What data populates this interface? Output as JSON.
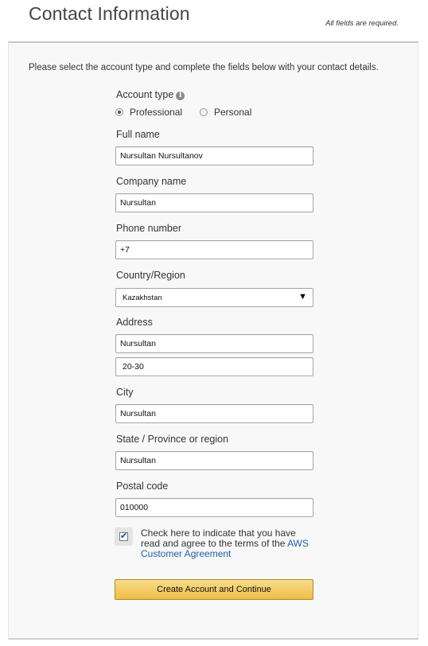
{
  "header": {
    "title": "Contact Information",
    "required_note": "All fields are required."
  },
  "intro": "Please select the account type and complete the fields below with your contact details.",
  "account_type": {
    "label": "Account type",
    "info_icon": "info-icon",
    "options": [
      {
        "label": "Professional",
        "selected": true
      },
      {
        "label": "Personal",
        "selected": false
      }
    ]
  },
  "fields": {
    "full_name": {
      "label": "Full name",
      "value": "Nursultan Nursultanov"
    },
    "company_name": {
      "label": "Company name",
      "value": "Nursultan"
    },
    "phone_number": {
      "label": "Phone number",
      "value": "+7"
    },
    "country": {
      "label": "Country/Region",
      "value": "Kazakhstan"
    },
    "address": {
      "label": "Address",
      "line1": "Nursultan",
      "line2": "20-30"
    },
    "city": {
      "label": "City",
      "value": "Nursultan"
    },
    "state": {
      "label": "State / Province or region",
      "value": "Nursultan"
    },
    "postal_code": {
      "label": "Postal code",
      "value": "010000"
    }
  },
  "agreement": {
    "checked": true,
    "text": "Check here to indicate that you have read and agree to the terms of the ",
    "link_text": "AWS Customer Agreement"
  },
  "submit_button": "Create Account and Continue",
  "colors": {
    "button_top": "#f8dc8c",
    "button_bottom": "#efbe45",
    "link": "#1f5fa6",
    "panel_bg": "#f8f8f8"
  }
}
